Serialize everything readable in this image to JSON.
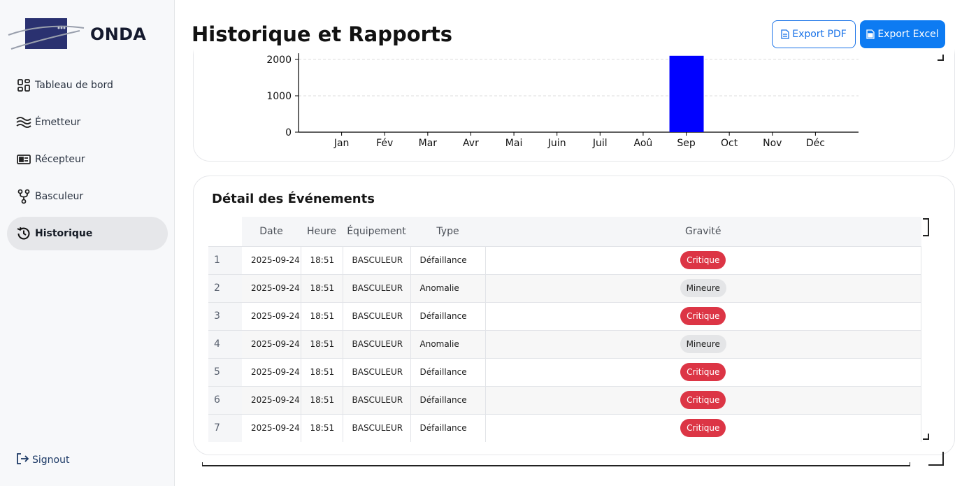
{
  "sidebar": {
    "brand": "ONDA",
    "items": [
      {
        "label": "Tableau de bord",
        "icon": "dashboard-icon",
        "active": false
      },
      {
        "label": "Émetteur",
        "icon": "waves-icon",
        "active": false
      },
      {
        "label": "Récepteur",
        "icon": "receiver-card-icon",
        "active": false
      },
      {
        "label": "Basculeur",
        "icon": "fork-icon",
        "active": false
      },
      {
        "label": "Historique",
        "icon": "history-icon",
        "active": true
      }
    ],
    "signout": "Signout"
  },
  "header": {
    "title": "Historique et Rapports",
    "export_pdf": "Export PDF",
    "export_excel": "Export Excel"
  },
  "colors": {
    "primary": "#0d7bf2",
    "bar": "#0000ff",
    "critique": "#dc3545",
    "mineure": "#e4e5e7"
  },
  "chart_data": {
    "type": "bar",
    "categories": [
      "Jan",
      "Fév",
      "Mar",
      "Avr",
      "Mai",
      "Juin",
      "Juil",
      "Aoû",
      "Sep",
      "Oct",
      "Nov",
      "Déc"
    ],
    "values": [
      0,
      0,
      0,
      0,
      0,
      0,
      0,
      0,
      2100,
      0,
      0,
      0
    ],
    "yticks": [
      0,
      1000,
      2000
    ],
    "ylim": [
      0,
      2200
    ],
    "grid": true
  },
  "events": {
    "title": "Détail des Événements",
    "columns": [
      "Date",
      "Heure",
      "Équipement",
      "Type",
      "Gravité"
    ],
    "rows": [
      {
        "index": "1",
        "date": "2025-09-24",
        "heure": "18:51",
        "equipement": "BASCULEUR",
        "type": "Défaillance",
        "gravite": "Critique"
      },
      {
        "index": "2",
        "date": "2025-09-24",
        "heure": "18:51",
        "equipement": "BASCULEUR",
        "type": "Anomalie",
        "gravite": "Mineure"
      },
      {
        "index": "3",
        "date": "2025-09-24",
        "heure": "18:51",
        "equipement": "BASCULEUR",
        "type": "Défaillance",
        "gravite": "Critique"
      },
      {
        "index": "4",
        "date": "2025-09-24",
        "heure": "18:51",
        "equipement": "BASCULEUR",
        "type": "Anomalie",
        "gravite": "Mineure"
      },
      {
        "index": "5",
        "date": "2025-09-24",
        "heure": "18:51",
        "equipement": "BASCULEUR",
        "type": "Défaillance",
        "gravite": "Critique"
      },
      {
        "index": "6",
        "date": "2025-09-24",
        "heure": "18:51",
        "equipement": "BASCULEUR",
        "type": "Défaillance",
        "gravite": "Critique"
      },
      {
        "index": "7",
        "date": "2025-09-24",
        "heure": "18:51",
        "equipement": "BASCULEUR",
        "type": "Défaillance",
        "gravite": "Critique"
      }
    ]
  }
}
